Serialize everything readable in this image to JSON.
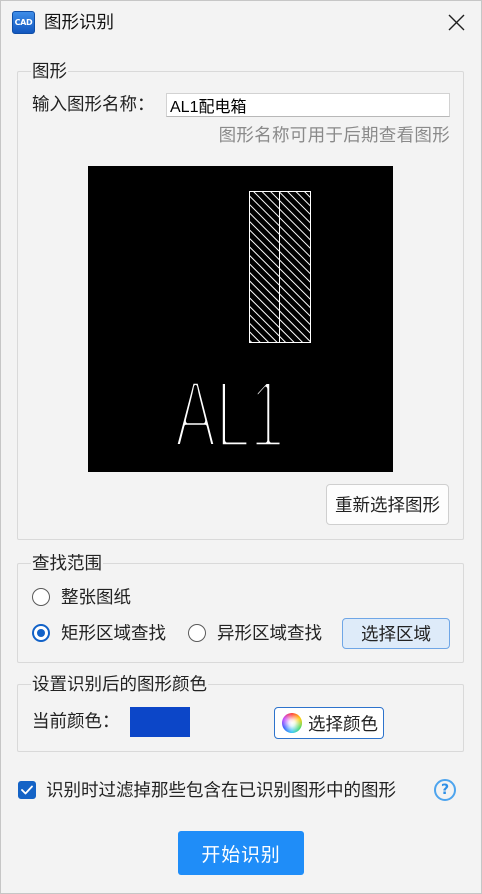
{
  "window": {
    "title": "图形识别",
    "icon_text": "CAD"
  },
  "icons": {
    "app": "cad-app-icon",
    "close": "close-icon",
    "color_wheel": "color-wheel-icon",
    "checkbox_check": "checkmark-icon",
    "help": "help-icon"
  },
  "shape_group": {
    "legend": "图形",
    "name_label": "输入图形名称：",
    "name_value": "AL1配电箱",
    "name_hint": "图形名称可用于后期查看图形",
    "preview": {
      "label": "AL1",
      "background": "#000000"
    },
    "reselect_button": "重新选择图形"
  },
  "search_scope": {
    "legend": "查找范围",
    "options": [
      {
        "label": "整张图纸",
        "checked": false
      },
      {
        "label": "矩形区域查找",
        "checked": true
      },
      {
        "label": "异形区域查找",
        "checked": false
      }
    ],
    "select_area_button": "选择区域"
  },
  "color_group": {
    "legend": "设置识别后的图形颜色",
    "current_color_label": "当前颜色：",
    "current_color": "#0c46c8",
    "choose_color_button": "选择颜色"
  },
  "filter_option": {
    "label": "识别时过滤掉那些包含在已识别图形中的图形",
    "checked": true,
    "help_glyph": "?"
  },
  "start_button": "开始识别",
  "colors": {
    "accent": "#1f8df8",
    "checked_control": "#1463c6",
    "dialog_background": "#f3f3f3"
  }
}
